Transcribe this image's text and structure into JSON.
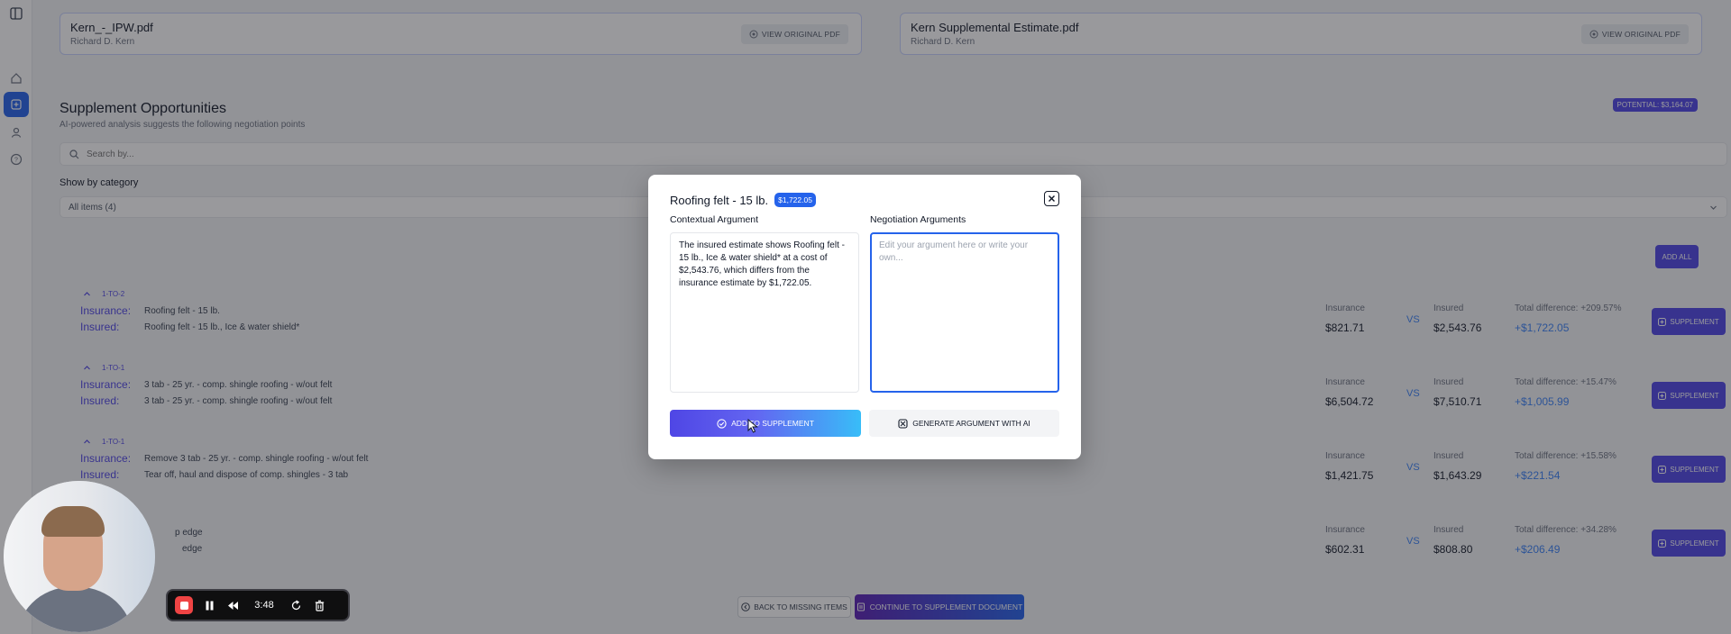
{
  "files": [
    {
      "name": "Kern_-_IPW.pdf",
      "owner": "Richard D. Kern",
      "action": "VIEW ORIGINAL PDF"
    },
    {
      "name": "Kern Supplemental Estimate.pdf",
      "owner": "Richard D. Kern",
      "action": "VIEW ORIGINAL PDF"
    }
  ],
  "section": {
    "title": "Supplement Opportunities",
    "subtitle": "AI-powered analysis suggests the following negotiation points",
    "potential": "POTENTIAL: $3,164.07",
    "search_placeholder": "Search by...",
    "category_label": "Show by category",
    "category_value": "All items (4)",
    "add_all": "ADD ALL"
  },
  "items": [
    {
      "tag": "1-TO-2",
      "label_insurance": "Insurance:",
      "label_insured": "Insured:",
      "insurance_text": "Roofing felt - 15 lb.",
      "insured_text": "Roofing felt - 15 lb., Ice & water shield*",
      "col_insurance": "Insurance",
      "insurance_value": "$821.71",
      "vs": "VS",
      "col_insured": "Insured",
      "insured_value": "$2,543.76",
      "difference_label": "Total difference: +209.57%",
      "difference_value": "+$1,722.05",
      "button": "SUPPLEMENT"
    },
    {
      "tag": "1-TO-1",
      "label_insurance": "Insurance:",
      "label_insured": "Insured:",
      "insurance_text": "3 tab - 25 yr. - comp. shingle roofing - w/out felt",
      "insured_text": "3 tab - 25 yr. - comp. shingle roofing - w/out felt",
      "col_insurance": "Insurance",
      "insurance_value": "$6,504.72",
      "vs": "VS",
      "col_insured": "Insured",
      "insured_value": "$7,510.71",
      "difference_label": "Total difference: +15.47%",
      "difference_value": "+$1,005.99",
      "button": "SUPPLEMENT"
    },
    {
      "tag": "1-TO-1",
      "label_insurance": "Insurance:",
      "label_insured": "Insured:",
      "insurance_text": "Remove 3 tab - 25 yr. - comp. shingle roofing - w/out felt",
      "insured_text": "Tear off, haul and dispose of comp. shingles - 3 tab",
      "col_insurance": "Insurance",
      "insurance_value": "$1,421.75",
      "vs": "VS",
      "col_insured": "Insured",
      "insured_value": "$1,643.29",
      "difference_label": "Total difference: +15.58%",
      "difference_value": "+$221.54",
      "button": "SUPPLEMENT"
    },
    {
      "tag": "",
      "label_insurance": "",
      "label_insured": "",
      "insurance_text": "p edge",
      "insured_text": "edge",
      "col_insurance": "Insurance",
      "insurance_value": "$602.31",
      "vs": "VS",
      "col_insured": "Insured",
      "insured_value": "$808.80",
      "difference_label": "Total difference: +34.28%",
      "difference_value": "+$206.49",
      "button": "SUPPLEMENT"
    }
  ],
  "footer": {
    "back": "BACK TO MISSING ITEMS",
    "continue": "CONTINUE TO SUPPLEMENT DOCUMENT"
  },
  "modal": {
    "title": "Roofing felt - 15 lb.",
    "badge": "$1,722.05",
    "contextual_label": "Contextual Argument",
    "negotiation_label": "Negotiation Arguments",
    "contextual_text": "The insured estimate shows Roofing felt - 15 lb., Ice & water shield* at a cost of $2,543.76, which differs from the insurance estimate by $1,722.05.",
    "negotiation_placeholder": "Edit your argument here or write your own...",
    "add_button": "ADD TO SUPPLEMENT",
    "generate_button": "GENERATE ARGUMENT WITH AI"
  },
  "recorder": {
    "time": "3:48"
  },
  "colors": {
    "accent": "#4f46e5",
    "link_blue": "#3b82f6",
    "primary_blue": "#2563eb",
    "record_red": "#ef4444"
  }
}
